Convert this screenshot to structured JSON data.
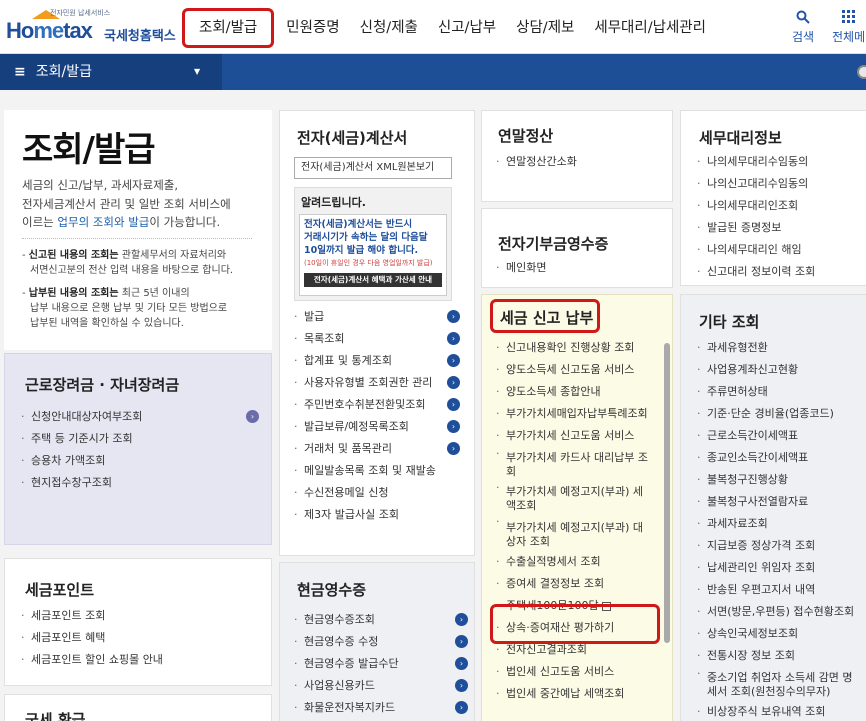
{
  "logo": {
    "small": "전자민원 납세서비스",
    "ho_a": "Ho",
    "ho_b": "me",
    "ho_c": "tax",
    "kr": "국세청홈택스"
  },
  "gnb": [
    "조회/발급",
    "민원증명",
    "신청/제출",
    "신고/납부",
    "상담/제보",
    "세무대리/납세관리"
  ],
  "util": {
    "search": "검색",
    "menu": "전체메"
  },
  "subbar": {
    "label": "조회/발급"
  },
  "intro": {
    "title": "조회/발급",
    "lines": [
      "세금의 신고/납부, 과세자료제출,",
      "전자세금계산서 관리 및 일반 조회 서비스에"
    ],
    "line3_a": "이르는 ",
    "line3_b": "업무의 조회와 발급",
    "line3_c": "이 가능합니다.",
    "note1_b": "신고된 내용의 조회는",
    "note1_a": " 관할세무서의 자료처리와",
    "note1_c": "서면신고분의 전산 입력 내용을 바탕으로 합니다.",
    "note2_b": "납부된 내용의 조회는",
    "note2_a": " 최근 5년 이내의",
    "note2_c": "납부 내용으로 은행 납부 및 기타 모든 방법으로",
    "note2_d": "납부된 내역을 확인하실 수 있습니다."
  },
  "labor": {
    "title": "근로장려금 · 자녀장려금",
    "items": [
      "신청안내대상자여부조회",
      "주택 등 기준시가 조회",
      "승용차 가액조회",
      "현지접수창구조회"
    ]
  },
  "point": {
    "title": "세금포인트",
    "items": [
      "세금포인트 조회",
      "세금포인트 혜택",
      "세금포인트 할인 쇼핑몰 안내"
    ]
  },
  "bottom_left": {
    "title": "국세 환급"
  },
  "einvoice": {
    "title": "전자(세금)계산서",
    "viewer": "전자(세금)계산서 XML원본보기",
    "notice_title": "알려드립니다.",
    "notice_l1": "전자(세금)계산서는 반드시",
    "notice_l2": "거래시기가 속하는 달의 다음달",
    "notice_l3": "10일까지 발급 해야 합니다.",
    "notice_l4": "(10일이 휴일인 경우 다음 영업일까지 발급)",
    "notice_btn": "전자(세금)계산서 혜택과 가산세 안내",
    "items": [
      "발급",
      "목록조회",
      "합계표 및 통계조회",
      "사용자유형별 조회권한 관리",
      "주민번호수취분전환및조회",
      "발급보류/예정목록조회",
      "거래처 및 품목관리",
      "메일발송목록 조회 및 재발송",
      "수신전용메일 신청",
      "제3자 발급사실 조회"
    ]
  },
  "cash": {
    "title": "현금영수증",
    "items": [
      "현금영수증조회",
      "현금영수증 수정",
      "현금영수증 발급수단",
      "사업용신용카드",
      "화물운전자복지카드"
    ]
  },
  "yearend": {
    "title": "연말정산",
    "items": [
      "연말정산간소화"
    ]
  },
  "donation": {
    "title": "전자기부금영수증",
    "items": [
      "메인화면"
    ]
  },
  "tax": {
    "title": "세금 신고 납부",
    "items": [
      "신고내용확인 진행상황 조회",
      "양도소득세 신고도움 서비스",
      "양도소득세 종합안내",
      "부가가치세매입자납부특례조회",
      "부가가치세 신고도움 서비스",
      "부가가치세 카드사 대리납부 조회",
      "부가가치세 예정고지(부과) 세액조회",
      "부가가치세 예정고지(부과) 대상자 조회",
      "수출실적명세서 조회",
      "증여세 결정정보 조회",
      "주택세100문100답",
      "상속·증여재산 평가하기",
      "전자신고결과조회",
      "법인세 신고도움 서비스",
      "법인세 중간예납 세액조회"
    ],
    "item6_l1": "부가가치세 카드사 대리납부 조",
    "item6_l2": "회",
    "item7_l1": "부가가치세 예정고지(부과) 세",
    "item7_l2": "액조회",
    "item8_l1": "부가가치세 예정고지(부과) 대",
    "item8_l2": "상자 조회"
  },
  "agent": {
    "title": "세무대리정보",
    "items": [
      "나의세무대리수임동의",
      "나의신고대리수임동의",
      "나의세무대리인조회",
      "발급된 증명정보",
      "나의세무대리인 해임",
      "신고대리 정보이력 조회"
    ]
  },
  "other": {
    "title": "기타 조회",
    "items": [
      "과세유형전환",
      "사업용계좌신고현황",
      "주류면허상태",
      "기준·단순 경비율(업종코드)",
      "근로소득간이세액표",
      "종교인소득간이세액표",
      "불복청구진행상황",
      "불복청구사전열람자료",
      "과세자료조회",
      "지급보증 정상가격 조회",
      "납세관리인 위임자 조회",
      "반송된 우편고지서 내역",
      "서면(방문,우편등) 접수현황조회",
      "상속인국세정보조회",
      "전통시장 정보 조회"
    ],
    "last_l1": "중소기업 취업자 소득세 감면 명",
    "last_l2": "세서 조회(원천징수의무자)",
    "cut": "비상장주식 보유내역 조회"
  }
}
